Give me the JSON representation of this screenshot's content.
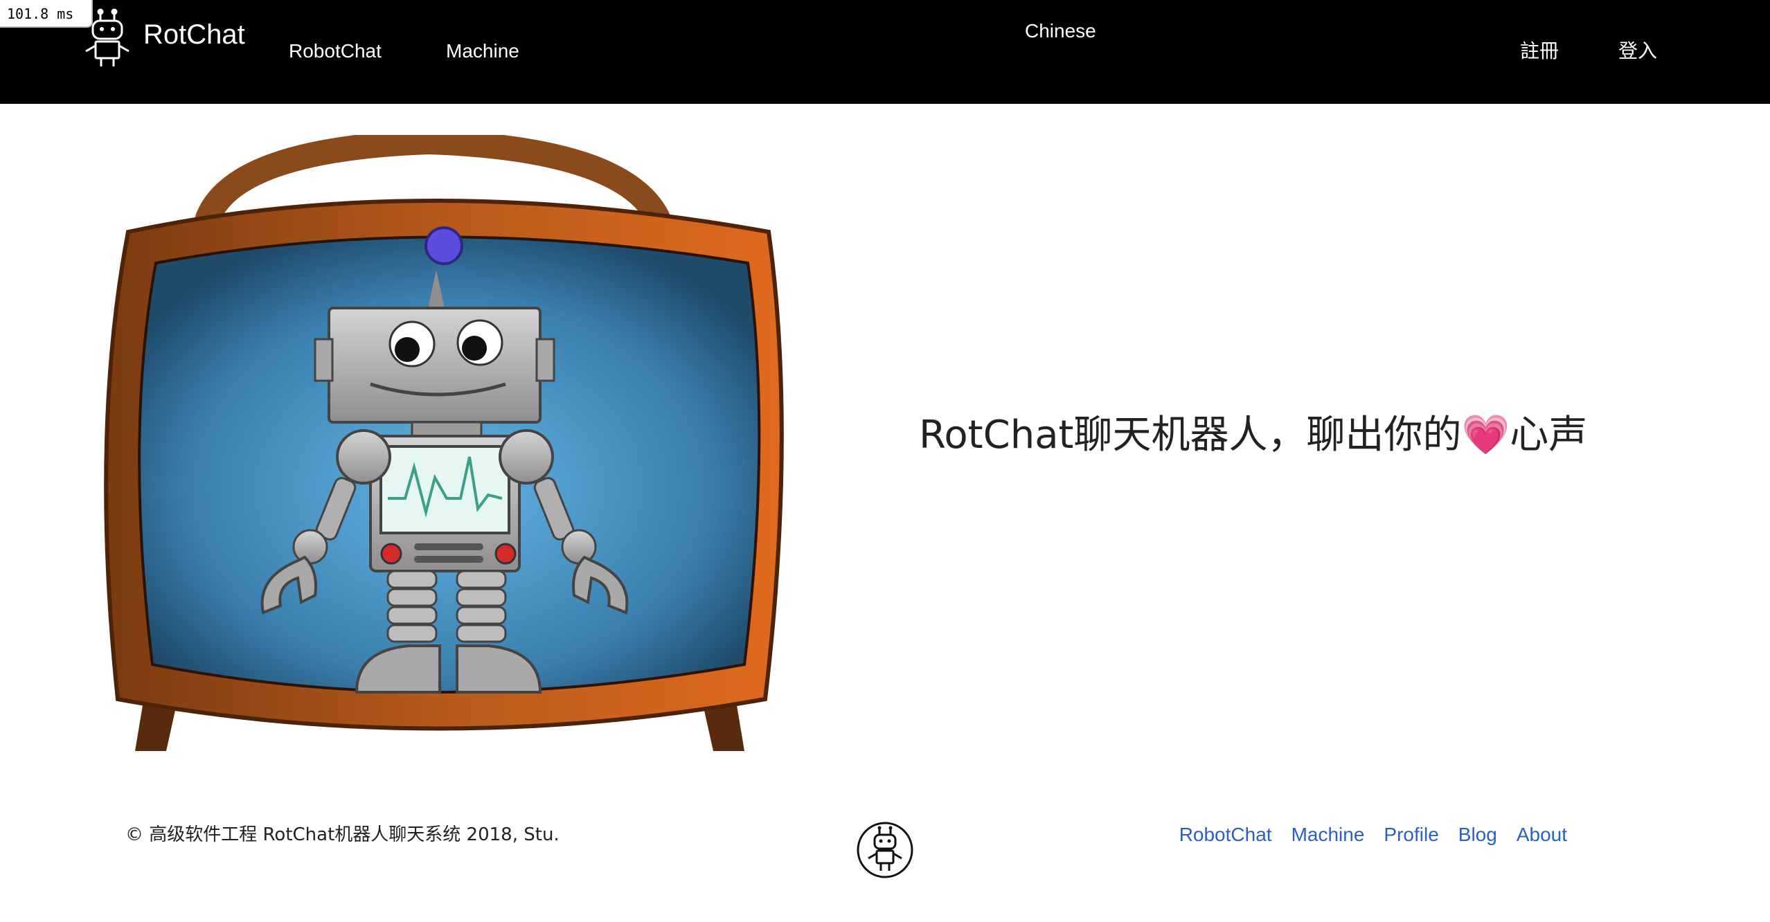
{
  "timing": {
    "label": "101.8 ms"
  },
  "navbar": {
    "brand": "RotChat",
    "links": {
      "robotchat": "RobotChat",
      "machine": "Machine",
      "language": "Chinese",
      "register": "註冊",
      "login": "登入"
    },
    "logo_icon": "robot-logo-icon"
  },
  "hero": {
    "image_icon": "robot-on-tv-illustration",
    "tagline_before": "RotChat聊天机器人，聊出你的",
    "tagline_emoji": "💗",
    "tagline_after": "心声"
  },
  "footer": {
    "copyright": "© 高级软件工程 RotChat机器人聊天系统 2018, Stu.",
    "logo_icon": "robot-logo-icon",
    "links": [
      "RobotChat",
      "Machine",
      "Profile",
      "Blog",
      "About"
    ]
  },
  "colors": {
    "navbar_bg": "#000000",
    "footer_link": "#2b5fc7",
    "tv_wood": "#c8611f",
    "screen_blue": "#3b86b2"
  }
}
